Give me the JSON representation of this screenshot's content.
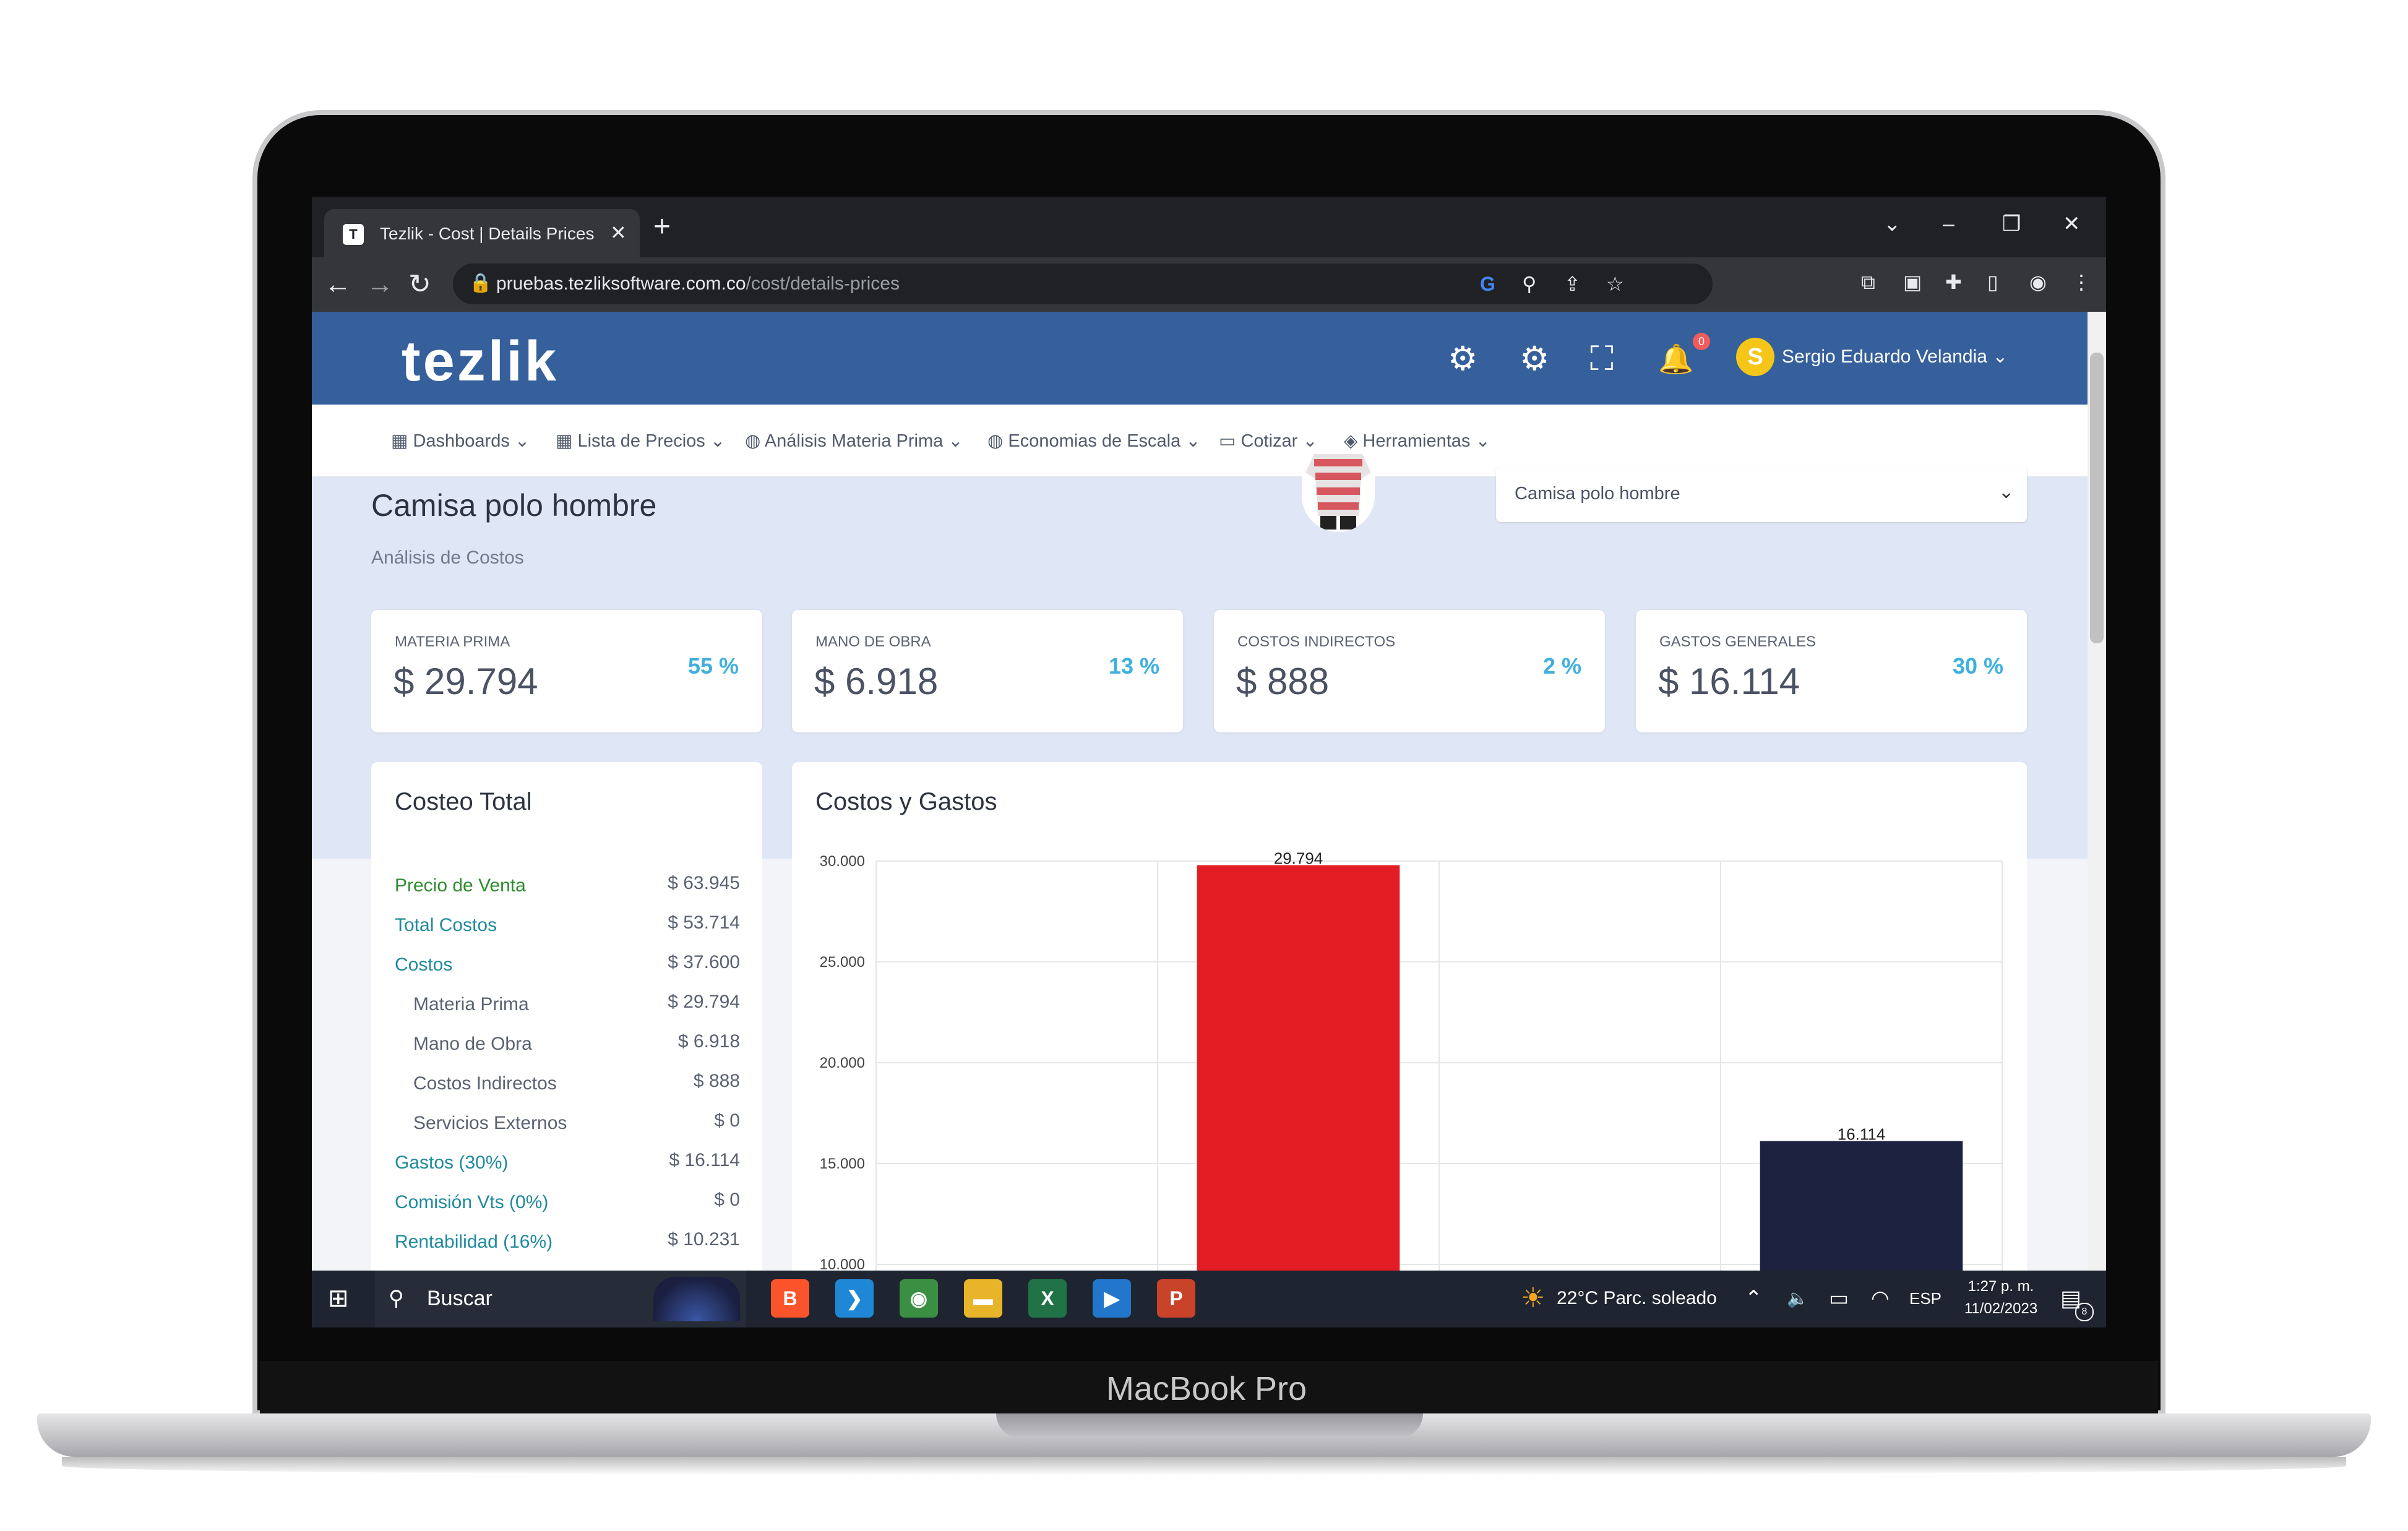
{
  "device": {
    "brand_label": "MacBook Pro"
  },
  "browser": {
    "tab_title": "Tezlik - Cost | Details Prices",
    "tab_favicon_label": "T",
    "close_glyph": "✕",
    "newtab_glyph": "+",
    "url_host": "pruebas.tezliksoftware.com.co",
    "url_path": "/cost/details-prices",
    "window_controls": {
      "chevron": "⌄",
      "minimize": "–",
      "restore": "❐",
      "close": "✕"
    },
    "nav": {
      "back": "←",
      "forward": "→",
      "reload": "↻"
    },
    "omnibox_icons": {
      "google": "G",
      "zoom": "⚲",
      "share": "⇪",
      "star": "☆"
    },
    "extension_icons": [
      "⧉",
      "▣",
      "✚",
      "▯",
      "◉",
      "⋮"
    ]
  },
  "app": {
    "logo": "tezlik",
    "header_icons": {
      "cog_outline": "⚙",
      "cog": "⚙",
      "fullscreen": "⛶",
      "bell": "🔔"
    },
    "notification_count": "0",
    "user": {
      "initial": "S",
      "name": "Sergio Eduardo Velandia ⌄"
    },
    "menu": [
      {
        "icon": "▦",
        "label": "Dashboards ⌄"
      },
      {
        "icon": "▦",
        "label": "Lista de Precios ⌄"
      },
      {
        "icon": "◍",
        "label": "Análisis Materia Prima ⌄"
      },
      {
        "icon": "◍",
        "label": "Economias de Escala ⌄"
      },
      {
        "icon": "▭",
        "label": "Cotizar ⌄"
      },
      {
        "icon": "◈",
        "label": "Herramientas ⌄"
      }
    ]
  },
  "product": {
    "title": "Camisa polo hombre",
    "subtitle": "Análisis de Costos",
    "select_value": "Camisa polo hombre",
    "select_caret": "⌄"
  },
  "cards": [
    {
      "label": "MATERIA PRIMA",
      "value": "$ 29.794",
      "pct": "55 %"
    },
    {
      "label": "MANO DE OBRA",
      "value": "$ 6.918",
      "pct": "13 %"
    },
    {
      "label": "COSTOS INDIRECTOS",
      "value": "$ 888",
      "pct": "2 %"
    },
    {
      "label": "GASTOS GENERALES",
      "value": "$ 16.114",
      "pct": "30 %"
    }
  ],
  "costeo": {
    "title": "Costeo Total",
    "rows": [
      {
        "label": "Precio de Venta",
        "value": "$ 63.945",
        "color": "#2e8b2e",
        "indent": false
      },
      {
        "label": "Total Costos",
        "value": "$ 53.714",
        "color": "#1f8a9e",
        "indent": false
      },
      {
        "label": "Costos",
        "value": "$ 37.600",
        "color": "#1f8a9e",
        "indent": false
      },
      {
        "label": "Materia Prima",
        "value": "$ 29.794",
        "color": "#5a6271",
        "indent": true
      },
      {
        "label": "Mano de Obra",
        "value": "$ 6.918",
        "color": "#5a6271",
        "indent": true
      },
      {
        "label": "Costos Indirectos",
        "value": "$ 888",
        "color": "#5a6271",
        "indent": true
      },
      {
        "label": "Servicios Externos",
        "value": "$ 0",
        "color": "#5a6271",
        "indent": true
      },
      {
        "label": "Gastos (30%)",
        "value": "$ 16.114",
        "color": "#1f8a9e",
        "indent": false
      },
      {
        "label": "Comisión Vts (0%)",
        "value": "$ 0",
        "color": "#1f8a9e",
        "indent": false
      },
      {
        "label": "Rentabilidad (16%)",
        "value": "$ 10.231",
        "color": "#1f8a9e",
        "indent": false
      }
    ]
  },
  "chart_data": {
    "type": "bar",
    "title": "Costos y Gastos",
    "categories": [
      "",
      "",
      "",
      ""
    ],
    "values": [
      null,
      29794,
      null,
      16114
    ],
    "value_labels": [
      "",
      "29.794",
      "",
      "16.114"
    ],
    "bar_colors": [
      "#e31d23",
      "#e31d23",
      "#1d2240",
      "#1d2240"
    ],
    "yticks": [
      "30.000",
      "25.000",
      "20.000",
      "15.000",
      "10.000"
    ],
    "ytick_values": [
      30000,
      25000,
      20000,
      15000,
      10000
    ],
    "ylim": [
      10000,
      30000
    ],
    "grid": true
  },
  "taskbar": {
    "search": "Buscar",
    "apps": [
      {
        "name": "brave",
        "glyph": "B",
        "color": "#fb542b"
      },
      {
        "name": "vscode",
        "glyph": "❯",
        "color": "#1e88d6"
      },
      {
        "name": "chrome",
        "glyph": "◉",
        "color": "#3b8f43"
      },
      {
        "name": "explorer",
        "glyph": "▬",
        "color": "#e8b42a"
      },
      {
        "name": "excel",
        "glyph": "X",
        "color": "#1f7346"
      },
      {
        "name": "photos",
        "glyph": "▶",
        "color": "#2277cc"
      },
      {
        "name": "powerpoint",
        "glyph": "P",
        "color": "#c8432a"
      }
    ],
    "weather": "22°C  Parc. soleado",
    "tray": {
      "chevron": "⌃",
      "volume": "🔈",
      "battery": "▭",
      "wifi": "◠",
      "lang": "ESP"
    },
    "time": "1:27 p. m.",
    "date": "11/02/2023",
    "notif_count": "8"
  }
}
